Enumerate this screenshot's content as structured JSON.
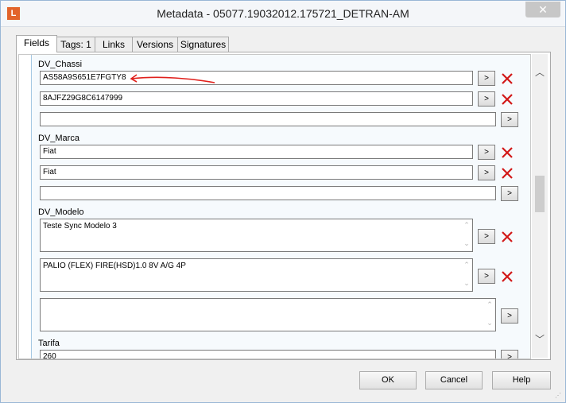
{
  "window": {
    "title": "Metadata - 05077.19032012.175721_DETRAN-AM",
    "app_icon_letter": "L",
    "close_glyph": "✕"
  },
  "tabs": [
    {
      "label": "Fields"
    },
    {
      "label": "Tags: 1"
    },
    {
      "label": "Links"
    },
    {
      "label": "Versions"
    },
    {
      "label": "Signatures"
    }
  ],
  "fields": {
    "chassi": {
      "label": "DV_Chassi",
      "values": [
        "AS58A9S651E7FGTY8",
        "8AJFZ29G8C6147999",
        ""
      ]
    },
    "marca": {
      "label": "DV_Marca",
      "values": [
        "Fiat",
        "Fiat",
        ""
      ]
    },
    "modelo": {
      "label": "DV_Modelo",
      "values": [
        "Teste Sync Modelo 3",
        "PALIO (FLEX) FIRE(HSD)1.0 8V A/G 4P",
        ""
      ]
    },
    "tarifa": {
      "label": "Tarifa",
      "values": [
        "260"
      ]
    }
  },
  "go_button_label": ">",
  "footer": {
    "ok": "OK",
    "cancel": "Cancel",
    "help": "Help"
  },
  "colors": {
    "delete_icon": "#d21818",
    "annotation_arrow": "#e0201c",
    "content_border": "#a6c8e3"
  }
}
